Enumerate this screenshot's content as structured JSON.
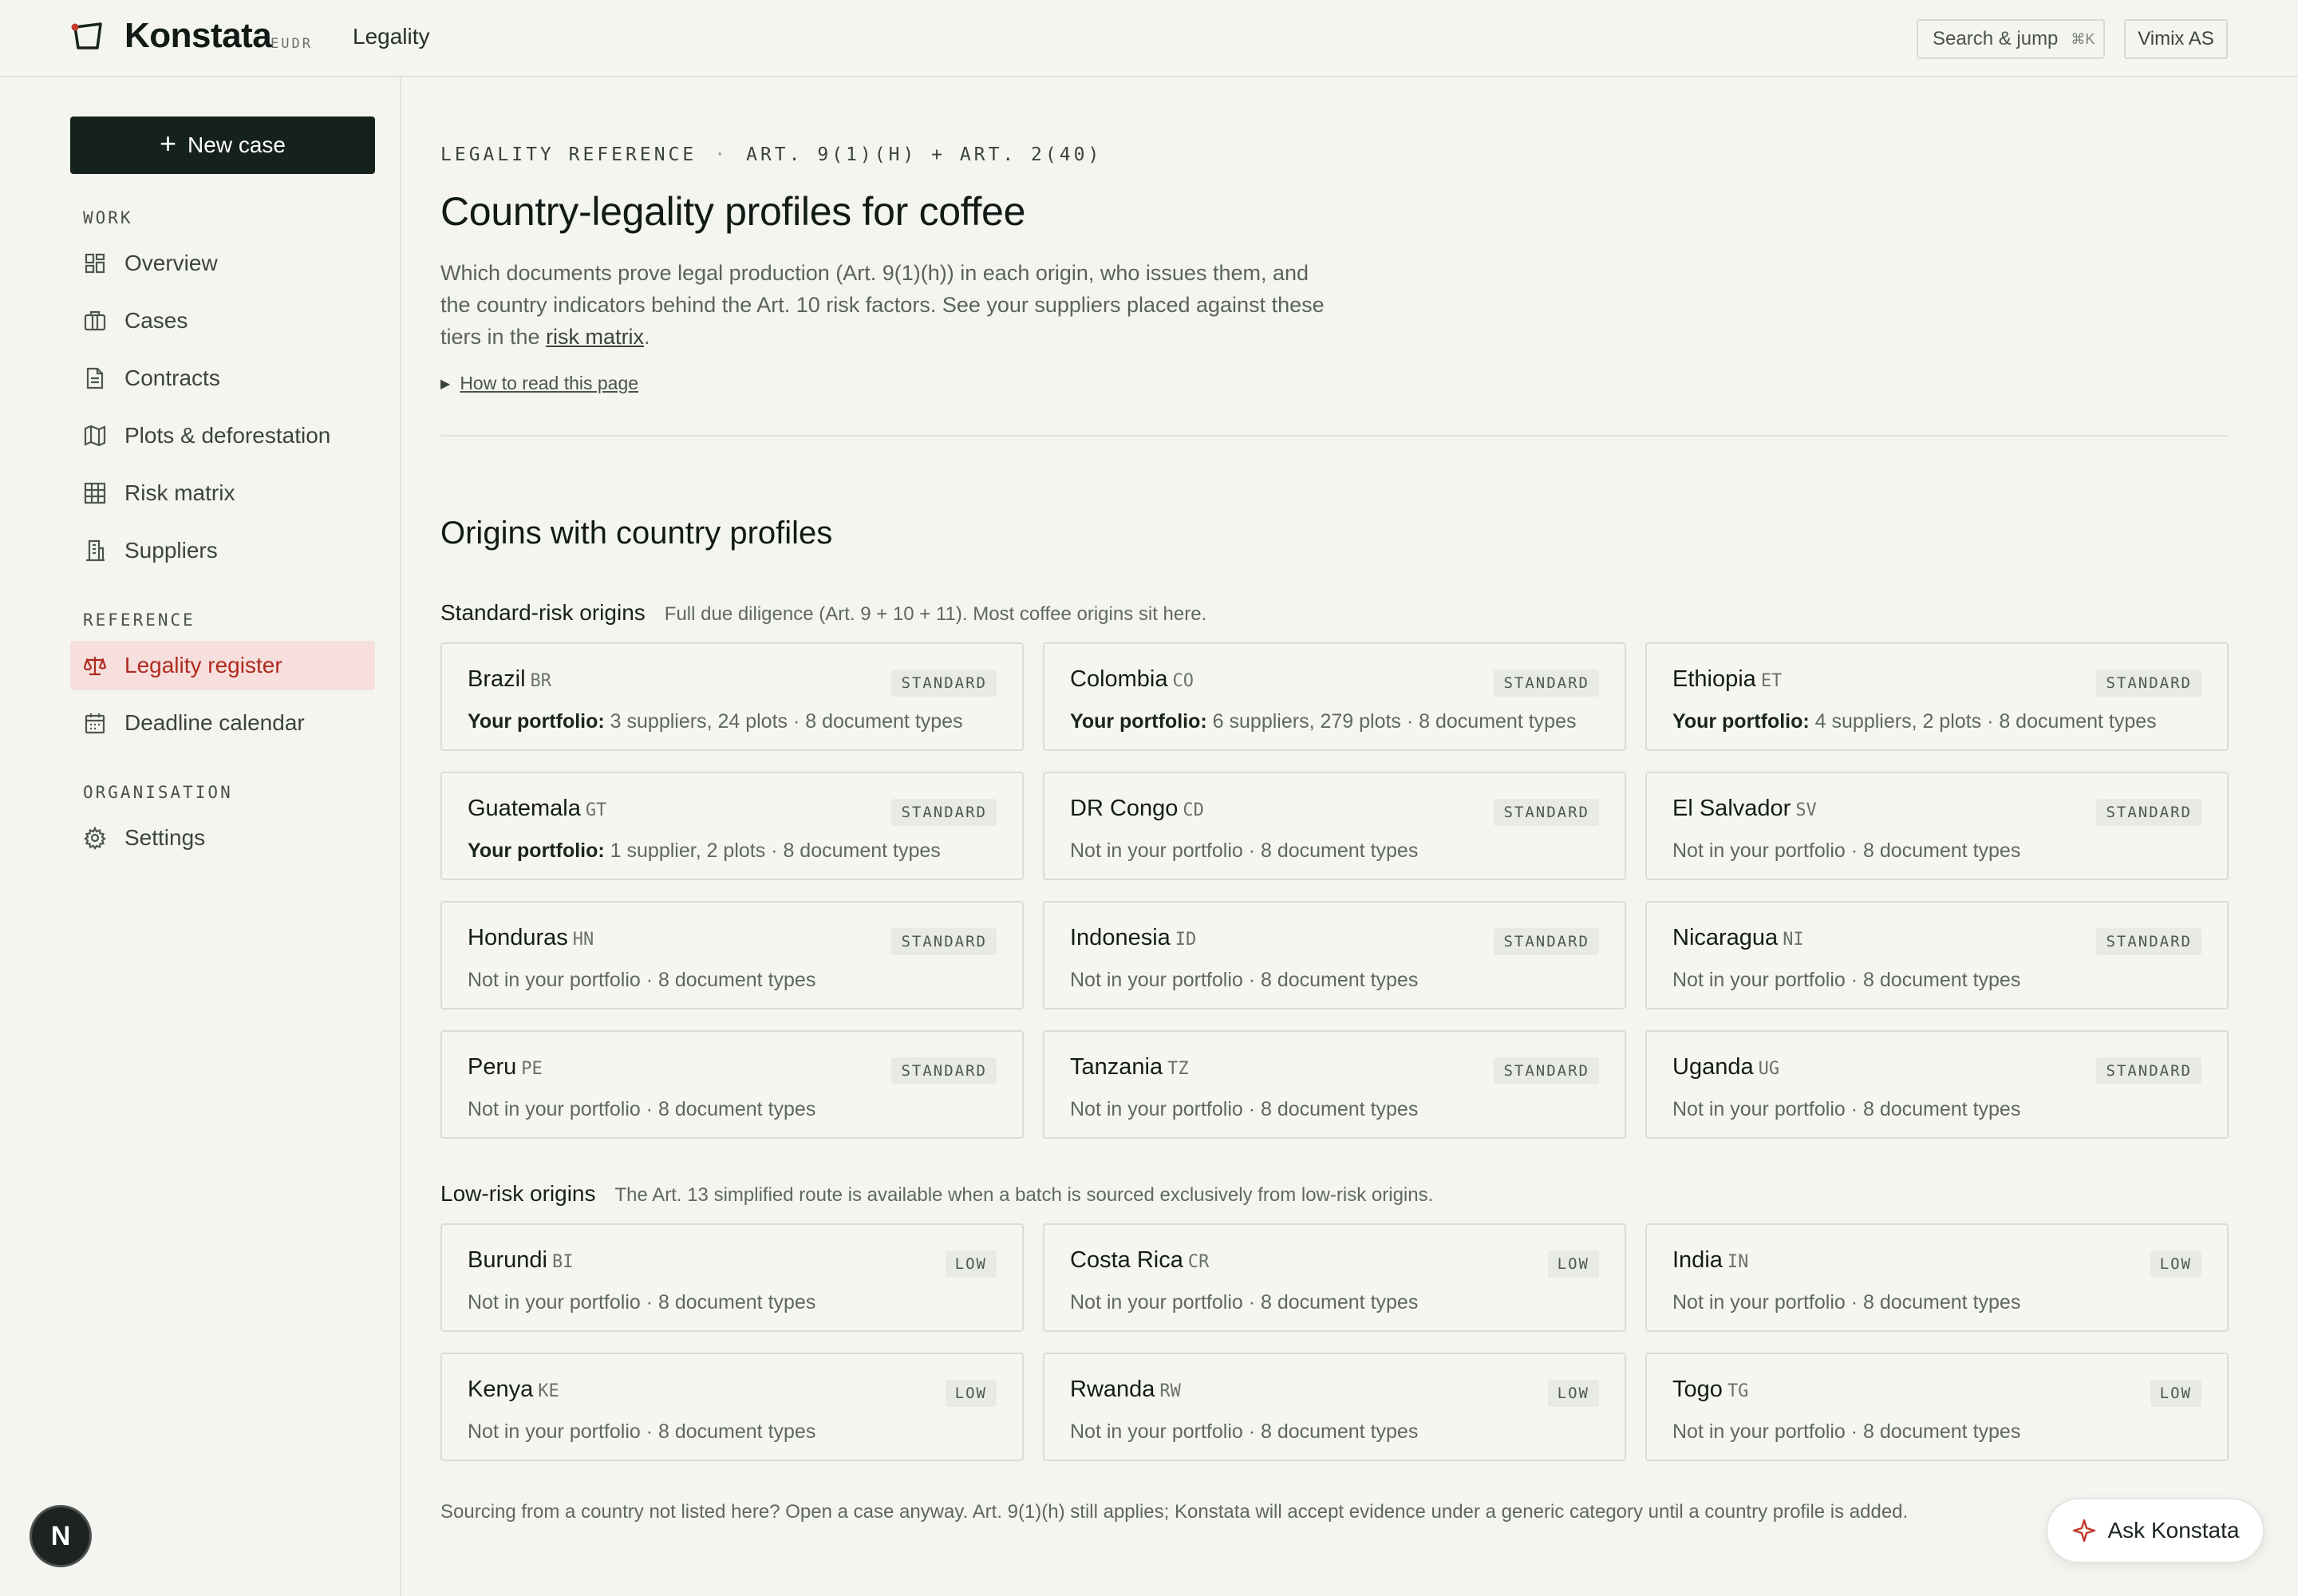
{
  "header": {
    "brand": "Konstata",
    "brand_tag": "EUDR",
    "section": "Legality",
    "search_label": "Search & jump",
    "search_shortcut": "⌘K",
    "org": "Vimix AS"
  },
  "sidebar": {
    "new_case": "New case",
    "groups": {
      "work": "WORK",
      "reference": "REFERENCE",
      "organisation": "ORGANISATION"
    },
    "items": [
      {
        "label": "Overview",
        "icon": "grid-icon"
      },
      {
        "label": "Cases",
        "icon": "briefcase-icon"
      },
      {
        "label": "Contracts",
        "icon": "document-icon"
      },
      {
        "label": "Plots & deforestation",
        "icon": "map-icon"
      },
      {
        "label": "Risk matrix",
        "icon": "table-icon"
      },
      {
        "label": "Suppliers",
        "icon": "building-icon"
      },
      {
        "label": "Legality register",
        "icon": "scale-icon",
        "active": true
      },
      {
        "label": "Deadline calendar",
        "icon": "calendar-icon"
      },
      {
        "label": "Settings",
        "icon": "gear-icon"
      }
    ]
  },
  "main": {
    "kicker_a": "LEGALITY REFERENCE",
    "kicker_sep": "·",
    "kicker_b": "ART. 9(1)(H) + ART. 2(40)",
    "title": "Country-legality profiles for coffee",
    "intro_text": "Which documents prove legal production (Art. 9(1)(h)) in each origin, who issues them, and the country indicators behind the Art. 10 risk factors. See your suppliers placed against these tiers in the ",
    "intro_link": "risk matrix",
    "intro_end": ".",
    "howto": "How to read this page",
    "section_title": "Origins with country profiles",
    "standard": {
      "title": "Standard-risk origins",
      "desc": "Full due diligence (Art. 9 + 10 + 11). Most coffee origins sit here.",
      "tier": "STANDARD",
      "cards": [
        {
          "name": "Brazil",
          "code": "BR",
          "portfolio_label": "Your portfolio:",
          "text": "3 suppliers, 24 plots · 8 document types"
        },
        {
          "name": "Colombia",
          "code": "CO",
          "portfolio_label": "Your portfolio:",
          "text": "6 suppliers, 279 plots · 8 document types"
        },
        {
          "name": "Ethiopia",
          "code": "ET",
          "portfolio_label": "Your portfolio:",
          "text": "4 suppliers, 2 plots · 8 document types"
        },
        {
          "name": "Guatemala",
          "code": "GT",
          "portfolio_label": "Your portfolio:",
          "text": "1 supplier, 2 plots · 8 document types"
        },
        {
          "name": "DR Congo",
          "code": "CD",
          "portfolio_label": "",
          "text": "Not in your portfolio · 8 document types"
        },
        {
          "name": "El Salvador",
          "code": "SV",
          "portfolio_label": "",
          "text": "Not in your portfolio · 8 document types"
        },
        {
          "name": "Honduras",
          "code": "HN",
          "portfolio_label": "",
          "text": "Not in your portfolio · 8 document types"
        },
        {
          "name": "Indonesia",
          "code": "ID",
          "portfolio_label": "",
          "text": "Not in your portfolio · 8 document types"
        },
        {
          "name": "Nicaragua",
          "code": "NI",
          "portfolio_label": "",
          "text": "Not in your portfolio · 8 document types"
        },
        {
          "name": "Peru",
          "code": "PE",
          "portfolio_label": "",
          "text": "Not in your portfolio · 8 document types"
        },
        {
          "name": "Tanzania",
          "code": "TZ",
          "portfolio_label": "",
          "text": "Not in your portfolio · 8 document types"
        },
        {
          "name": "Uganda",
          "code": "UG",
          "portfolio_label": "",
          "text": "Not in your portfolio · 8 document types"
        }
      ]
    },
    "low": {
      "title": "Low-risk origins",
      "desc": "The Art. 13 simplified route is available when a batch is sourced exclusively from low-risk origins.",
      "tier": "LOW",
      "cards": [
        {
          "name": "Burundi",
          "code": "BI",
          "portfolio_label": "",
          "text": "Not in your portfolio · 8 document types"
        },
        {
          "name": "Costa Rica",
          "code": "CR",
          "portfolio_label": "",
          "text": "Not in your portfolio · 8 document types"
        },
        {
          "name": "India",
          "code": "IN",
          "portfolio_label": "",
          "text": "Not in your portfolio · 8 document types"
        },
        {
          "name": "Kenya",
          "code": "KE",
          "portfolio_label": "",
          "text": "Not in your portfolio · 8 document types"
        },
        {
          "name": "Rwanda",
          "code": "RW",
          "portfolio_label": "",
          "text": "Not in your portfolio · 8 document types"
        },
        {
          "name": "Togo",
          "code": "TG",
          "portfolio_label": "",
          "text": "Not in your portfolio · 8 document types"
        }
      ]
    },
    "footnote": "Sourcing from a country not listed here? Open a case anyway. Art. 9(1)(h) still applies; Konstata will accept evidence under a generic category until a country profile is added."
  },
  "floating": {
    "avatar": "N",
    "ask": "Ask Konstata"
  },
  "colors": {
    "accent": "#b02a20",
    "active_bg": "#f6dfdc",
    "primary_button": "#15221b"
  }
}
